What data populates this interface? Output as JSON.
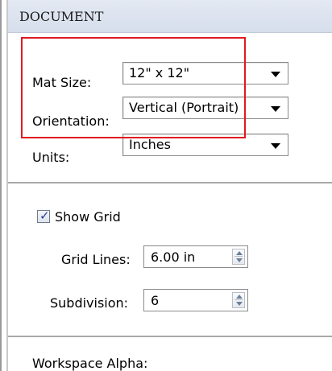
{
  "section": {
    "title": "DOCUMENT"
  },
  "mat_size": {
    "label": "Mat Size:",
    "value": "12\" x 12\""
  },
  "orientation": {
    "label": "Orientation:",
    "value": "Vertical (Portrait)"
  },
  "units": {
    "label": "Units:",
    "value": "Inches"
  },
  "show_grid": {
    "label": "Show Grid",
    "checked": true
  },
  "grid_lines": {
    "label": "Grid Lines:",
    "value": "6.00 in"
  },
  "subdivision": {
    "label": "Subdivision:",
    "value": "6"
  },
  "workspace_alpha": {
    "label": "Workspace Alpha:"
  },
  "colors": {
    "highlight": "#e0191f",
    "header_bg": "#dbe2ef",
    "check_mark": "#1f3fa8"
  }
}
